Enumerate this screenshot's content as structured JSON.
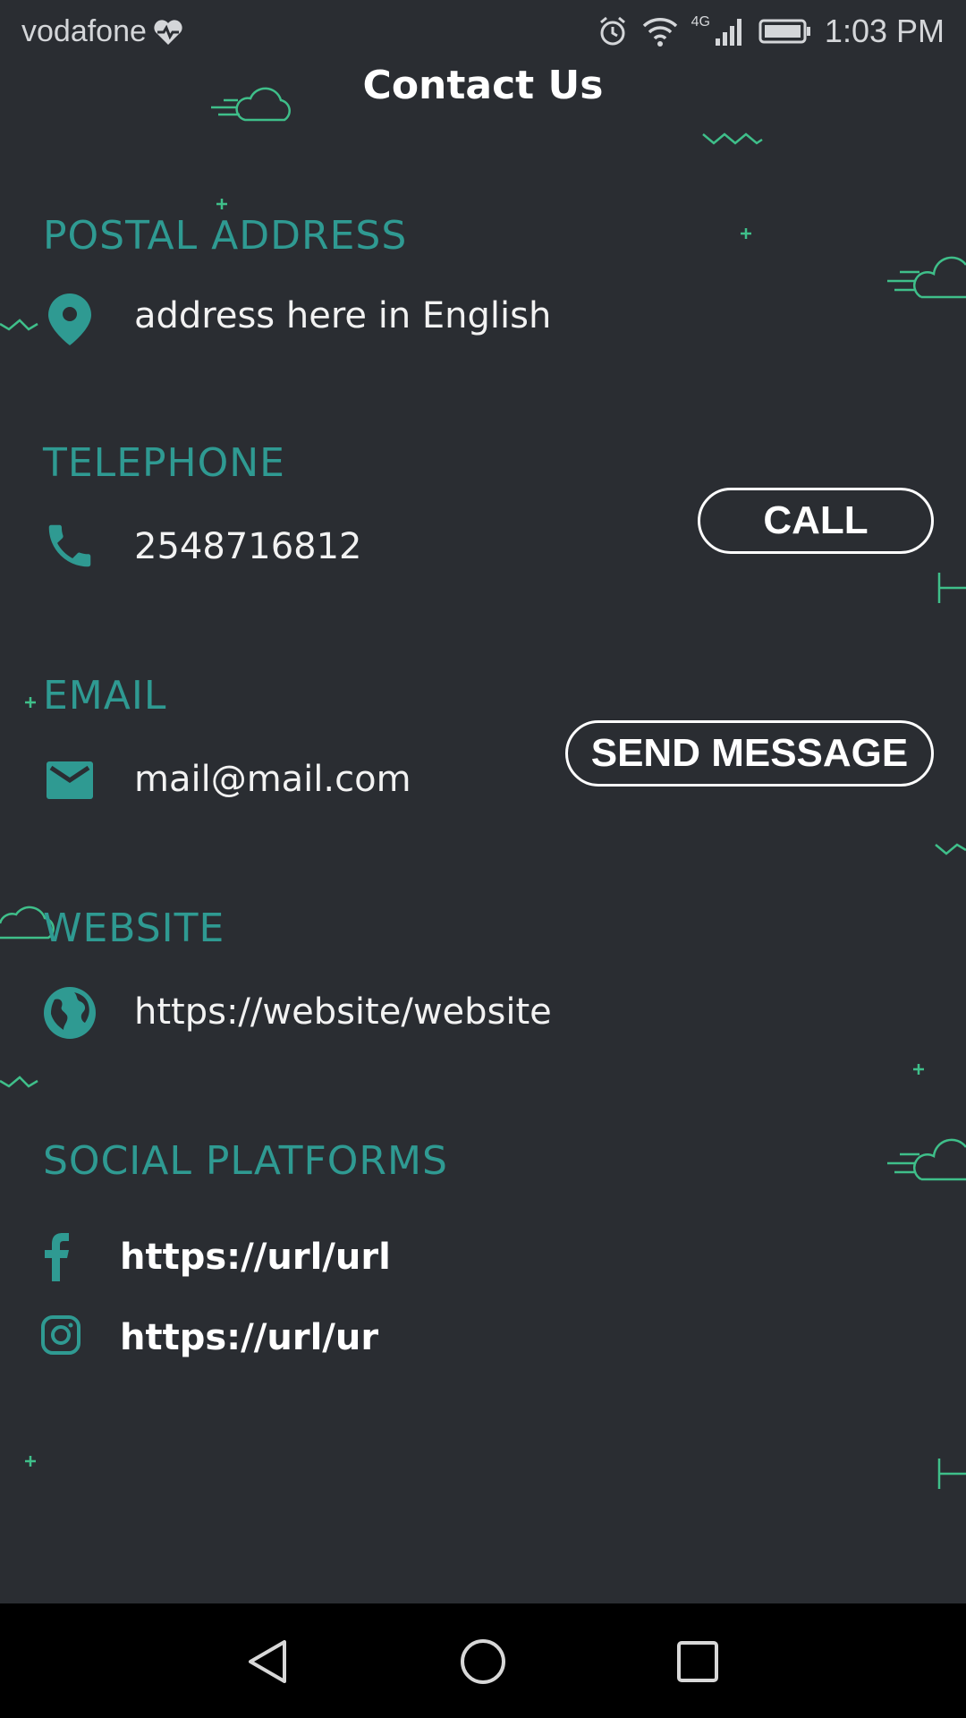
{
  "status_bar": {
    "carrier": "vodafone",
    "network": "4G",
    "time": "1:03 PM"
  },
  "header": {
    "title": "Contact Us"
  },
  "sections": {
    "postal": {
      "heading": "POSTAL ADDRESS",
      "value": "address here in English",
      "icon": "location-pin-icon"
    },
    "telephone": {
      "heading": "TELEPHONE",
      "value": "2548716812",
      "icon": "phone-icon",
      "button": "CALL"
    },
    "email": {
      "heading": "EMAIL",
      "value": "mail@mail.com",
      "icon": "mail-icon",
      "button": "SEND MESSAGE"
    },
    "website": {
      "heading": "WEBSITE",
      "value": "https://website/website",
      "icon": "globe-icon"
    },
    "social": {
      "heading": "SOCIAL PLATFORMS",
      "items": [
        {
          "icon": "facebook-icon",
          "url": "https://url/url"
        },
        {
          "icon": "instagram-icon",
          "url": "https://url/ur"
        }
      ]
    }
  },
  "colors": {
    "background": "#2a2d32",
    "accent": "#2f9a92",
    "decoration": "#3fbf8a",
    "nav_bar": "#000000"
  }
}
